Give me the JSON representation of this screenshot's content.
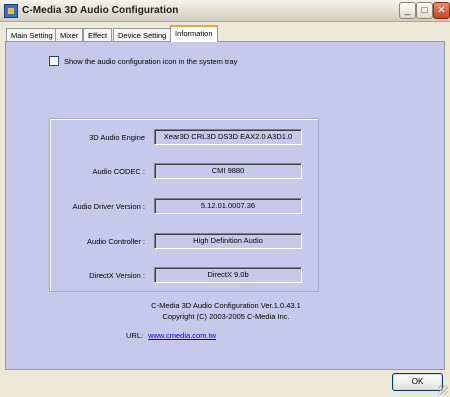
{
  "window": {
    "title": "C-Media 3D Audio Configuration",
    "minimize": "_",
    "maximize": "□",
    "close": "✕"
  },
  "tabs": [
    {
      "label": "Main Setting"
    },
    {
      "label": "Mixer"
    },
    {
      "label": "Effect"
    },
    {
      "label": "Device Setting"
    },
    {
      "label": "Information",
      "active": true
    }
  ],
  "tray_option": {
    "label": "Show the audio configuration icon in the system tray",
    "checked": false
  },
  "info": [
    {
      "label": "3D Audio Engine",
      "value": "Xear3D  CRL3D  DS3D  EAX2.0  A3D1.0"
    },
    {
      "label": "Audio CODEC :",
      "value": "CMI 9880"
    },
    {
      "label": "Audio Driver Version :",
      "value": "5.12.01.0007.36"
    },
    {
      "label": "Audio Controller :",
      "value": "High Definition Audio"
    },
    {
      "label": "DirectX Version :",
      "value": "DirectX 9.0b"
    }
  ],
  "credits": {
    "line1": "C-Media 3D Audio Configuration Ver.1.0.43.1",
    "line2": "Copyright (C) 2003-2005 C-Media Inc.",
    "url_label": "URL:",
    "url": "www.cmedia.com.tw"
  },
  "buttons": {
    "ok": "OK"
  },
  "colors": {
    "panel": "#c8c8ea",
    "window": "#ece9d8",
    "link": "#0000ee",
    "active_tab_accent": "#f1a63b"
  }
}
